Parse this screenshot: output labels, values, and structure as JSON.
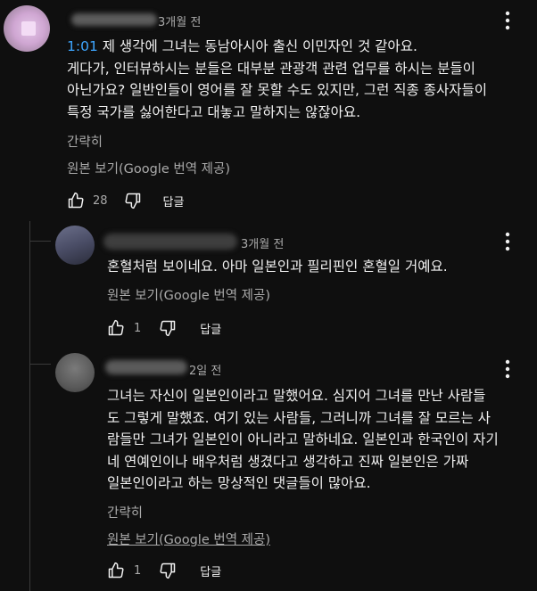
{
  "comments": [
    {
      "time": "3개월 전",
      "timestamp": "1:01",
      "lines": [
        " 제 생각에 그녀는 동남아시아 출신 이민자인 것 같아요.",
        "게다가, 인터뷰하시는 분들은 대부분 관광객 관련 업무를 하시는 분들이",
        "아닌가요? 일반인들이 영어를 잘 못할 수도 있지만, 그런 직종 종사자들이",
        "특정 국가를 싫어한다고 대놓고 말하지는 않잖아요."
      ],
      "collapse": "간략히",
      "translation": "원본 보기(Google 번역 제공)",
      "likes": "28",
      "reply_label": "답글"
    },
    {
      "time": "3개월 전",
      "lines": [
        "혼혈처럼 보이네요. 아마 일본인과 필리핀인 혼혈일 거예요."
      ],
      "translation": "원본 보기(Google 번역 제공)",
      "likes": "1",
      "reply_label": "답글"
    },
    {
      "time": "2일 전",
      "lines": [
        "그녀는 자신이 일본인이라고 말했어요. 심지어 그녀를 만난 사람들",
        "도 그렇게 말했죠. 여기 있는 사람들, 그러니까 그녀를 잘 모르는 사",
        "람들만 그녀가 일본인이 아니라고 말하네요. 일본인과 한국인이 자기",
        "네 연예인이나 배우처럼 생겼다고 생각하고 진짜 일본인은 가짜",
        "일본인이라고 하는 망상적인 댓글들이 많아요."
      ],
      "collapse": "간략히",
      "translation": "원본 보기(Google 번역 제공)",
      "likes": "1",
      "reply_label": "답글"
    }
  ]
}
